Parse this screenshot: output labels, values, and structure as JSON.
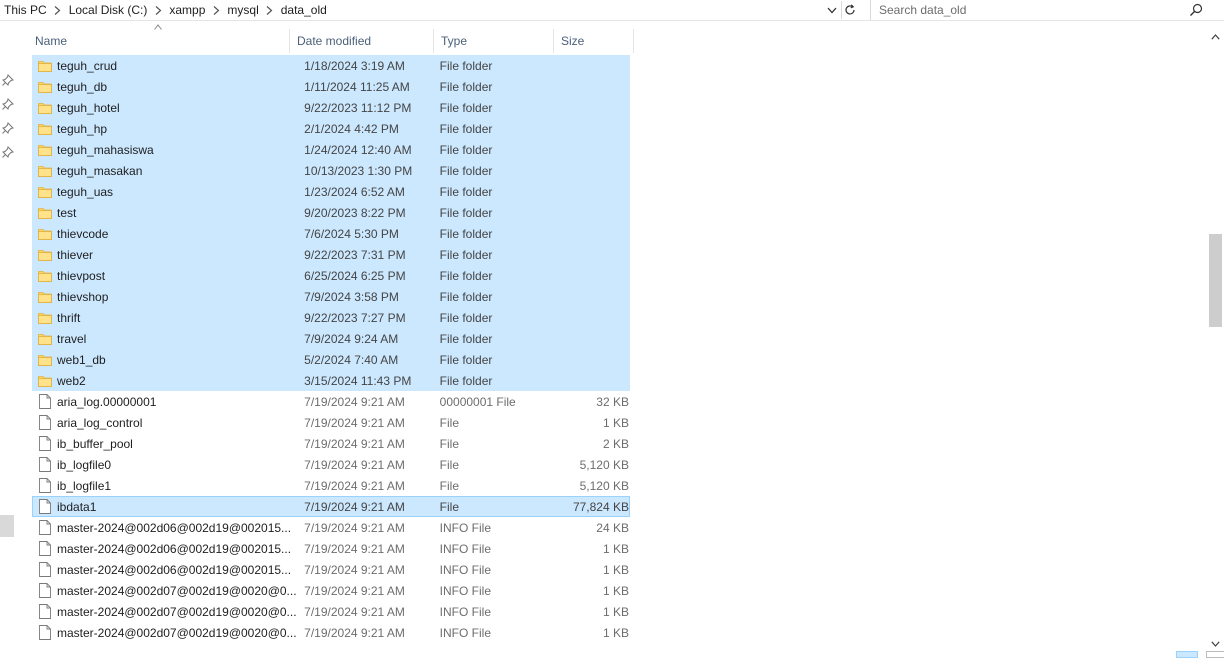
{
  "address": {
    "crumbs": [
      "This PC",
      "Local Disk (C:)",
      "xampp",
      "mysql",
      "data_old"
    ]
  },
  "search": {
    "placeholder": "Search data_old"
  },
  "columns": {
    "name": "Name",
    "date": "Date modified",
    "type": "Type",
    "size": "Size"
  },
  "rows": [
    {
      "name": "teguh_crud",
      "date": "1/18/2024 3:19 AM",
      "type": "File folder",
      "size": "",
      "kind": "folder",
      "state": "sel"
    },
    {
      "name": "teguh_db",
      "date": "1/11/2024 11:25 AM",
      "type": "File folder",
      "size": "",
      "kind": "folder",
      "state": "sel"
    },
    {
      "name": "teguh_hotel",
      "date": "9/22/2023 11:12 PM",
      "type": "File folder",
      "size": "",
      "kind": "folder",
      "state": "sel"
    },
    {
      "name": "teguh_hp",
      "date": "2/1/2024 4:42 PM",
      "type": "File folder",
      "size": "",
      "kind": "folder",
      "state": "sel"
    },
    {
      "name": "teguh_mahasiswa",
      "date": "1/24/2024 12:40 AM",
      "type": "File folder",
      "size": "",
      "kind": "folder",
      "state": "sel"
    },
    {
      "name": "teguh_masakan",
      "date": "10/13/2023 1:30 PM",
      "type": "File folder",
      "size": "",
      "kind": "folder",
      "state": "sel"
    },
    {
      "name": "teguh_uas",
      "date": "1/23/2024 6:52 AM",
      "type": "File folder",
      "size": "",
      "kind": "folder",
      "state": "sel"
    },
    {
      "name": "test",
      "date": "9/20/2023 8:22 PM",
      "type": "File folder",
      "size": "",
      "kind": "folder",
      "state": "sel"
    },
    {
      "name": "thievcode",
      "date": "7/6/2024 5:30 PM",
      "type": "File folder",
      "size": "",
      "kind": "folder",
      "state": "sel"
    },
    {
      "name": "thiever",
      "date": "9/22/2023 7:31 PM",
      "type": "File folder",
      "size": "",
      "kind": "folder",
      "state": "sel"
    },
    {
      "name": "thievpost",
      "date": "6/25/2024 6:25 PM",
      "type": "File folder",
      "size": "",
      "kind": "folder",
      "state": "sel"
    },
    {
      "name": "thievshop",
      "date": "7/9/2024 3:58 PM",
      "type": "File folder",
      "size": "",
      "kind": "folder",
      "state": "sel"
    },
    {
      "name": "thrift",
      "date": "9/22/2023 7:27 PM",
      "type": "File folder",
      "size": "",
      "kind": "folder",
      "state": "sel"
    },
    {
      "name": "travel",
      "date": "7/9/2024 9:24 AM",
      "type": "File folder",
      "size": "",
      "kind": "folder",
      "state": "sel"
    },
    {
      "name": "web1_db",
      "date": "5/2/2024 7:40 AM",
      "type": "File folder",
      "size": "",
      "kind": "folder",
      "state": "sel"
    },
    {
      "name": "web2",
      "date": "3/15/2024 11:43 PM",
      "type": "File folder",
      "size": "",
      "kind": "folder",
      "state": "sel"
    },
    {
      "name": "aria_log.00000001",
      "date": "7/19/2024 9:21 AM",
      "type": "00000001 File",
      "size": "32 KB",
      "kind": "file",
      "state": ""
    },
    {
      "name": "aria_log_control",
      "date": "7/19/2024 9:21 AM",
      "type": "File",
      "size": "1 KB",
      "kind": "file",
      "state": ""
    },
    {
      "name": "ib_buffer_pool",
      "date": "7/19/2024 9:21 AM",
      "type": "File",
      "size": "2 KB",
      "kind": "file",
      "state": ""
    },
    {
      "name": "ib_logfile0",
      "date": "7/19/2024 9:21 AM",
      "type": "File",
      "size": "5,120 KB",
      "kind": "file",
      "state": ""
    },
    {
      "name": "ib_logfile1",
      "date": "7/19/2024 9:21 AM",
      "type": "File",
      "size": "5,120 KB",
      "kind": "file",
      "state": ""
    },
    {
      "name": "ibdata1",
      "date": "7/19/2024 9:21 AM",
      "type": "File",
      "size": "77,824 KB",
      "kind": "file",
      "state": "focus"
    },
    {
      "name": "master-2024@002d06@002d19@002015...",
      "date": "7/19/2024 9:21 AM",
      "type": "INFO File",
      "size": "24 KB",
      "kind": "file",
      "state": ""
    },
    {
      "name": "master-2024@002d06@002d19@002015...",
      "date": "7/19/2024 9:21 AM",
      "type": "INFO File",
      "size": "1 KB",
      "kind": "file",
      "state": ""
    },
    {
      "name": "master-2024@002d06@002d19@002015...",
      "date": "7/19/2024 9:21 AM",
      "type": "INFO File",
      "size": "1 KB",
      "kind": "file",
      "state": ""
    },
    {
      "name": "master-2024@002d07@002d19@0020@0...",
      "date": "7/19/2024 9:21 AM",
      "type": "INFO File",
      "size": "1 KB",
      "kind": "file",
      "state": ""
    },
    {
      "name": "master-2024@002d07@002d19@0020@0...",
      "date": "7/19/2024 9:21 AM",
      "type": "INFO File",
      "size": "1 KB",
      "kind": "file",
      "state": ""
    },
    {
      "name": "master-2024@002d07@002d19@0020@0...",
      "date": "7/19/2024 9:21 AM",
      "type": "INFO File",
      "size": "1 KB",
      "kind": "file",
      "state": ""
    }
  ],
  "colors": {
    "selection": "#cce8ff",
    "selection_border": "#99d1ff",
    "folder": "#ffd766",
    "header_text": "#4c607a"
  },
  "icons": {
    "folder": "folder-icon",
    "file": "file-icon",
    "pin": "pin-icon",
    "search": "search-icon",
    "refresh": "refresh-icon"
  }
}
